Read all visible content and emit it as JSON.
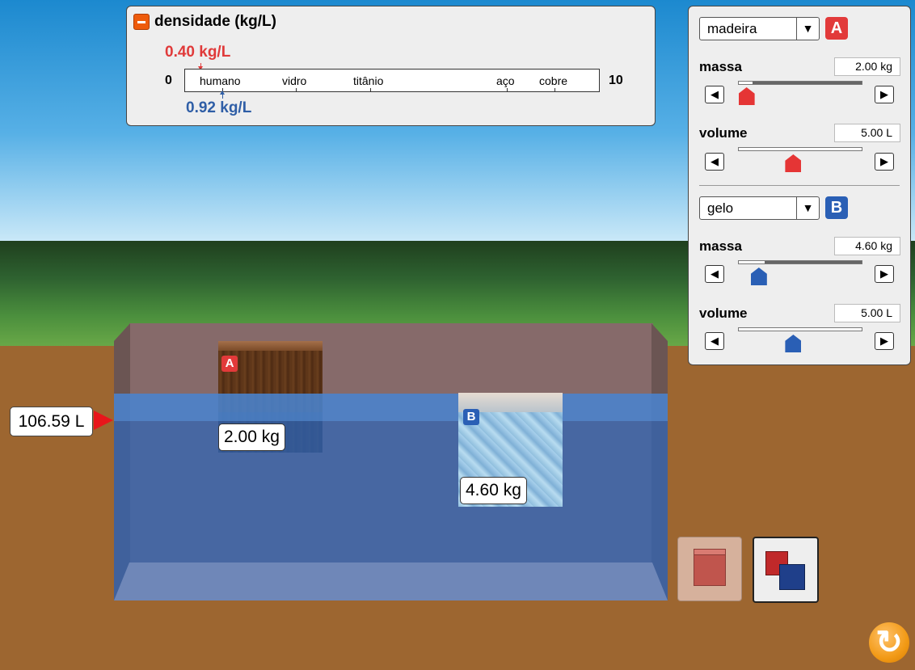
{
  "density_panel": {
    "title": "densidade (kg/L)",
    "scale_min": "0",
    "scale_max": "10",
    "tick_labels": [
      "humano",
      "vidro",
      "titânio",
      "aço",
      "cobre"
    ],
    "density_a": "0.40 kg/L",
    "density_b": "0.92 kg/L",
    "colors": {
      "a": "#e03a3a",
      "b": "#2f5ea6"
    }
  },
  "tank": {
    "volume_readout": "106.59 L",
    "block_a": {
      "tag": "A",
      "mass_label": "2.00 kg"
    },
    "block_b": {
      "tag": "B",
      "mass_label": "4.60 kg"
    }
  },
  "controls": {
    "block_a": {
      "material": "madeira",
      "badge": "A",
      "mass_label": "massa",
      "mass_value": "2.00 kg",
      "mass_fraction": 0.07,
      "volume_label": "volume",
      "volume_value": "5.00 L",
      "volume_fraction": 0.45
    },
    "block_b": {
      "material": "gelo",
      "badge": "B",
      "mass_label": "massa",
      "mass_value": "4.60 kg",
      "mass_fraction": 0.17,
      "volume_label": "volume",
      "volume_value": "5.00 L",
      "volume_fraction": 0.45
    },
    "icons": {
      "step_left": "◀",
      "step_right": "▶",
      "dropdown": "▼"
    }
  },
  "buttons": {
    "one_block_mode": "one-block-icon",
    "two_blocks_mode": "two-blocks-icon",
    "reset": "reset-icon"
  }
}
